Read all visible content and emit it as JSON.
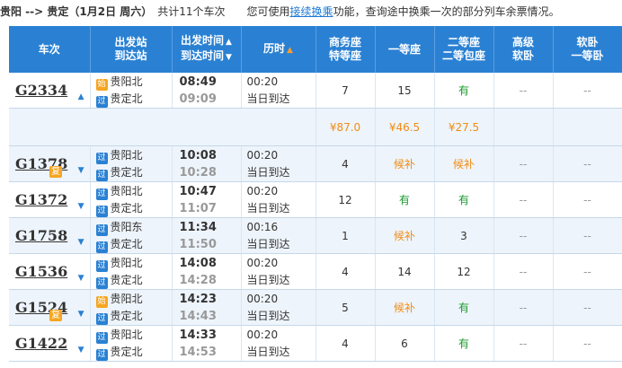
{
  "topbar": {
    "route": "贵阳 --> 贵定（1月2日  周六）",
    "count": "共计11个车次",
    "notice_before": "您可使用",
    "notice_link": "接续换乘",
    "notice_after": "功能，查询途中换乘一次的部分列车余票情况。"
  },
  "header": {
    "train_no": "车次",
    "from_station": "出发站",
    "to_station": "到达站",
    "dep_time": "出发时间",
    "arr_time": "到达时间",
    "duration": "历时",
    "business_1": "商务座",
    "business_2": "特等座",
    "first": "一等座",
    "second_1": "二等座",
    "second_2": "二等包座",
    "soft_sleeper_1": "高级",
    "soft_sleeper_2": "软卧",
    "soft_first_1": "软卧",
    "soft_first_2": "一等卧",
    "sort_up": "▲",
    "sort_down": "▼"
  },
  "badges": {
    "start": "始",
    "pass": "过",
    "fu": "复"
  },
  "trains": [
    {
      "no": "G2334",
      "from": "贵阳北",
      "to": "贵定北",
      "from_type": "start",
      "dep": "08:49",
      "arr": "09:09",
      "dur": "00:20",
      "day": "当日到达",
      "business": "7",
      "first": "15",
      "second": "有",
      "sleeper": "--",
      "sleeper2": "--",
      "fu": false,
      "expanded": true
    },
    {
      "no": "G1378",
      "from": "贵阳北",
      "to": "贵定北",
      "from_type": "pass",
      "dep": "10:08",
      "arr": "10:28",
      "dur": "00:20",
      "day": "当日到达",
      "business": "4",
      "first": "候补",
      "second": "候补",
      "sleeper": "--",
      "sleeper2": "--",
      "fu": true
    },
    {
      "no": "G1372",
      "from": "贵阳北",
      "to": "贵定北",
      "from_type": "pass",
      "dep": "10:47",
      "arr": "11:07",
      "dur": "00:20",
      "day": "当日到达",
      "business": "12",
      "first": "有",
      "second": "有",
      "sleeper": "--",
      "sleeper2": "--",
      "fu": false
    },
    {
      "no": "G1758",
      "from": "贵阳东",
      "to": "贵定北",
      "from_type": "pass",
      "dep": "11:34",
      "arr": "11:50",
      "dur": "00:16",
      "day": "当日到达",
      "business": "1",
      "first": "候补",
      "second": "3",
      "sleeper": "--",
      "sleeper2": "--",
      "fu": false
    },
    {
      "no": "G1536",
      "from": "贵阳北",
      "to": "贵定北",
      "from_type": "pass",
      "dep": "14:08",
      "arr": "14:28",
      "dur": "00:20",
      "day": "当日到达",
      "business": "4",
      "first": "14",
      "second": "12",
      "sleeper": "--",
      "sleeper2": "--",
      "fu": false
    },
    {
      "no": "G1524",
      "from": "贵阳北",
      "to": "贵定北",
      "from_type": "start",
      "dep": "14:23",
      "arr": "14:43",
      "dur": "00:20",
      "day": "当日到达",
      "business": "5",
      "first": "候补",
      "second": "有",
      "sleeper": "--",
      "sleeper2": "--",
      "fu": true
    },
    {
      "no": "G1422",
      "from": "贵阳北",
      "to": "贵定北",
      "from_type": "pass",
      "dep": "14:33",
      "arr": "14:53",
      "dur": "00:20",
      "day": "当日到达",
      "business": "4",
      "first": "6",
      "second": "有",
      "sleeper": "--",
      "sleeper2": "--",
      "fu": false
    }
  ],
  "prices": {
    "business": "¥87.0",
    "first": "¥46.5",
    "second": "¥27.5"
  },
  "colors": {
    "header_bg": "#2a81d3",
    "link": "#1c7ad5",
    "available": "#1a9b2e",
    "waitlist": "#f08c14",
    "row_alt": "#eef4fb"
  }
}
